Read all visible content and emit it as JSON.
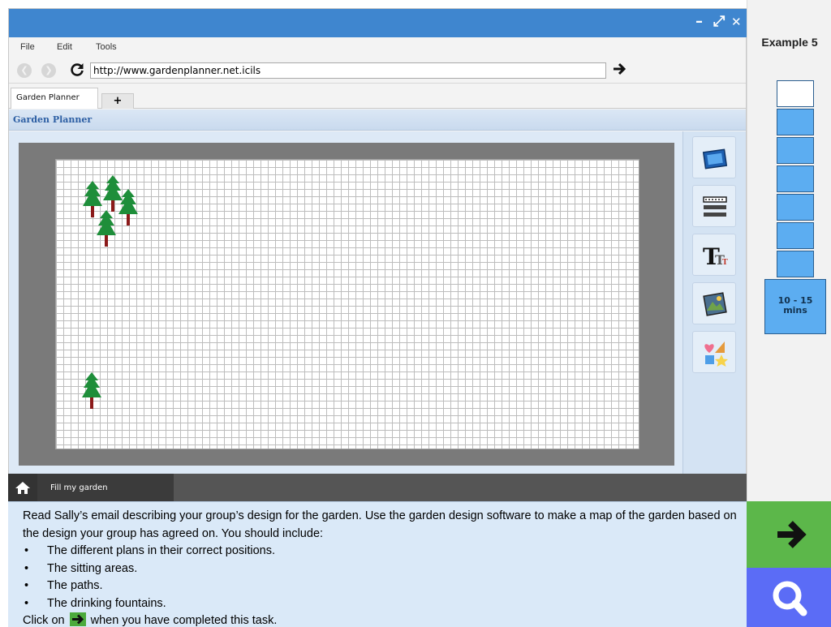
{
  "window": {
    "controls": {
      "minimize": "–",
      "maximize": "⤢",
      "close": "✕"
    },
    "menu": [
      "File",
      "Edit",
      "Tools"
    ],
    "address": "http://www.gardenplanner.net.icils",
    "tabs": {
      "active": "Garden Planner",
      "new_tab": "+"
    }
  },
  "app": {
    "title": "Garden Planner",
    "tools": [
      "photo-tool-icon",
      "fence-tool-icon",
      "text-tool-icon",
      "image-tool-icon",
      "shapes-tool-icon"
    ],
    "colors": {
      "tree_foliage": "#1e8e3a",
      "tree_trunk": "#8b1a1a",
      "grid_line": "#bdbdbd",
      "canvas_frame": "#7a7a7a"
    }
  },
  "taskbar": {
    "home_icon": "home-icon",
    "task_tab": "Fill my garden"
  },
  "instructions": {
    "intro": "Read Sally’s email describing your group’s design for the garden. Use the garden design software to make a map of the garden based on the design your group has agreed on. You should include:",
    "bullets": [
      "The different plans in their correct positions.",
      "The sitting areas.",
      "The paths.",
      "The drinking fountains."
    ],
    "bullet_char": "•",
    "footer_before": "Click on",
    "footer_after": "when you have completed this task."
  },
  "side_panel": {
    "example": "Example 5",
    "progress_total": 7,
    "progress_completed": 1,
    "time_top": "10 - 15",
    "time_bottom": "mins",
    "colors": {
      "progress": "#5cadf1",
      "next": "#5cb74a",
      "search": "#5b6cf6"
    },
    "next_icon": "arrow-right-icon",
    "search_icon": "search-icon"
  }
}
